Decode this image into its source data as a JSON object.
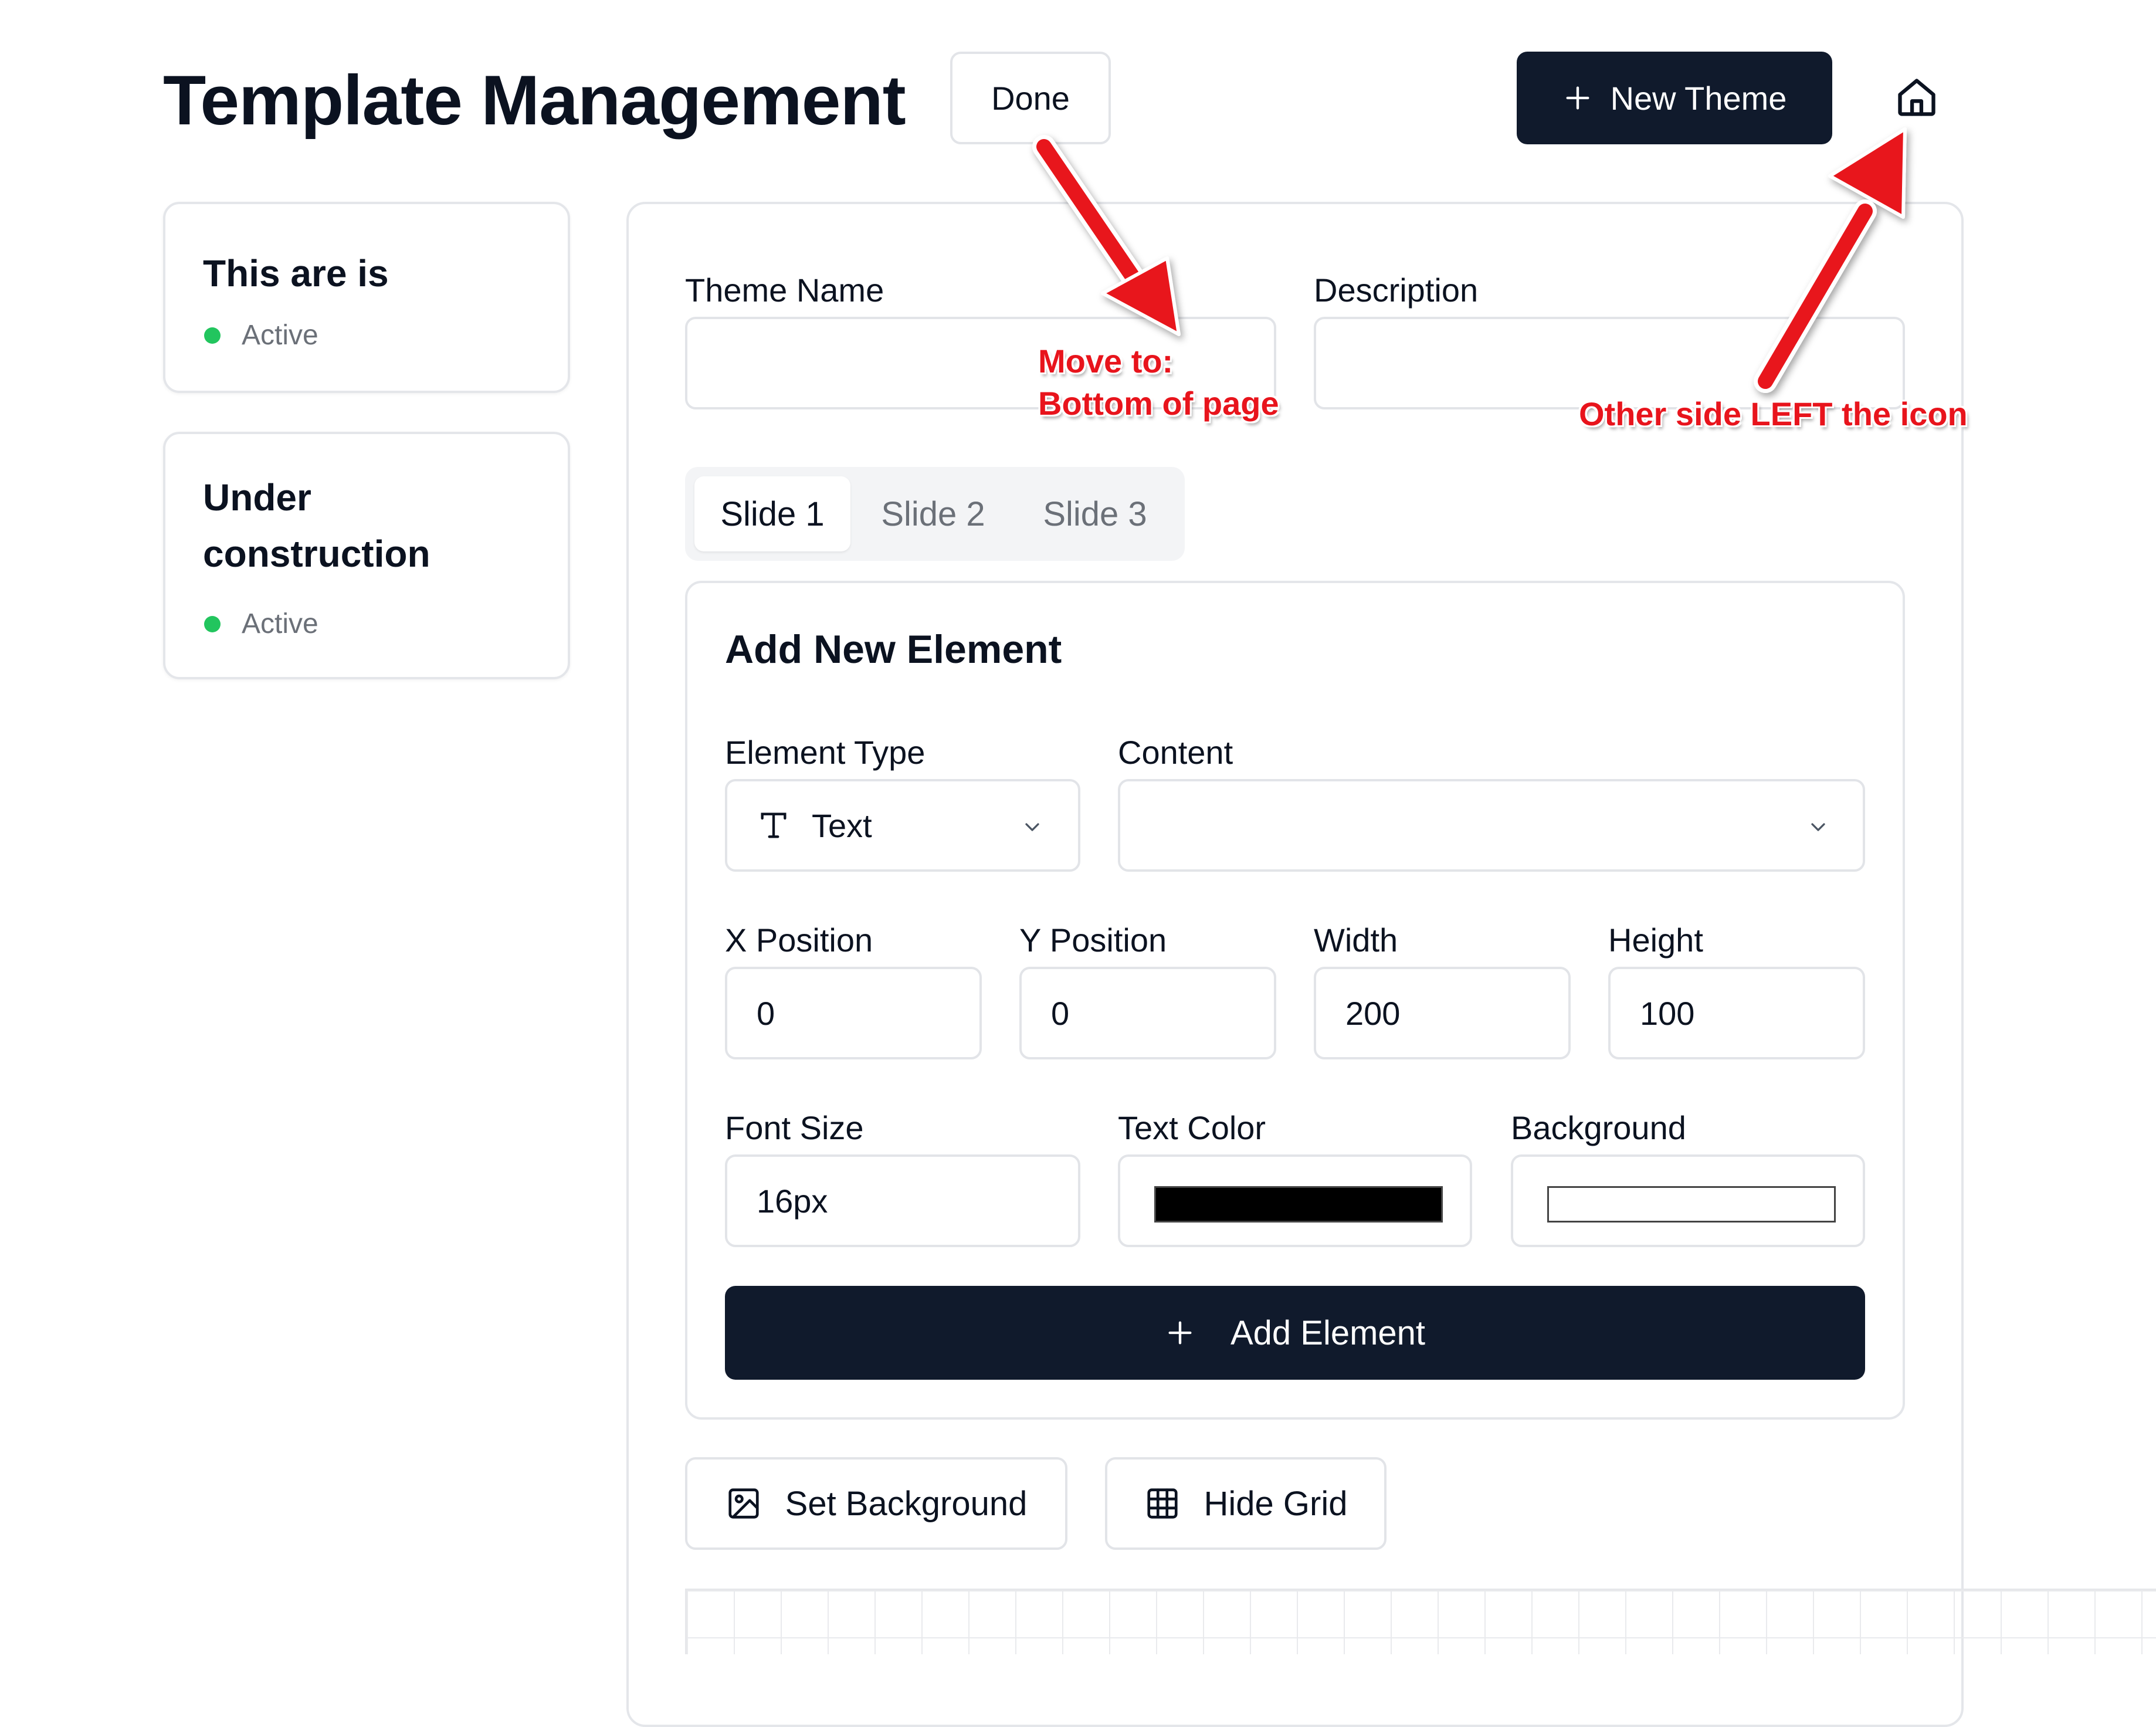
{
  "header": {
    "title": "Template Management",
    "done_label": "Done",
    "new_theme_label": "New Theme",
    "home_icon": "home-icon"
  },
  "sidebar": {
    "items": [
      {
        "title": "This are is",
        "status": "Active",
        "status_color": "#22c55e"
      },
      {
        "title": "Under construction",
        "status": "Active",
        "status_color": "#22c55e"
      }
    ]
  },
  "theme_form": {
    "theme_name_label": "Theme Name",
    "theme_name_value": "",
    "description_label": "Description",
    "description_value": ""
  },
  "slides": {
    "tabs": [
      {
        "label": "Slide 1",
        "active": true
      },
      {
        "label": "Slide 2",
        "active": false
      },
      {
        "label": "Slide 3",
        "active": false
      }
    ]
  },
  "add_element": {
    "heading": "Add New Element",
    "element_type_label": "Element Type",
    "element_type_value": "Text",
    "element_type_icon": "text-type-icon",
    "content_label": "Content",
    "content_value": "",
    "x_label": "X Position",
    "x_value": "0",
    "y_label": "Y Position",
    "y_value": "0",
    "width_label": "Width",
    "width_value": "200",
    "height_label": "Height",
    "height_value": "100",
    "font_size_label": "Font Size",
    "font_size_value": "16px",
    "text_color_label": "Text Color",
    "text_color_value": "#000000",
    "background_label": "Background",
    "background_value": "#ffffff",
    "submit_label": "Add Element"
  },
  "toolbar": {
    "set_background_label": "Set Background",
    "hide_grid_label": "Hide Grid"
  },
  "annotations": {
    "move_note_line1": "Move to:",
    "move_note_line2": "Bottom of page",
    "icon_note": "Other side LEFT the icon",
    "arrow_color": "#e8141c"
  },
  "colors": {
    "primary_dark": "#101a2c",
    "border": "#e2e4e8",
    "muted_text": "#6b7078",
    "active_green": "#22c55e"
  }
}
